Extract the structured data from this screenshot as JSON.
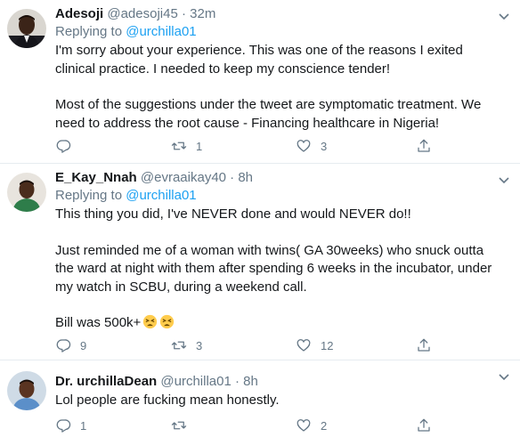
{
  "tweets": [
    {
      "name": "Adesoji",
      "handle": "@adesoji45",
      "separator": "·",
      "time": "32m",
      "replying_prefix": "Replying to",
      "replying_to": "@urchilla01",
      "paragraphs": [
        "I'm sorry about your experience. This was one of the reasons I exited clinical practice. I needed to keep my conscience tender!",
        "Most of the suggestions under the tweet are symptomatic treatment. We need to address the root cause - Financing healthcare in Nigeria!"
      ],
      "reply_count": "",
      "retweet_count": "1",
      "like_count": "3"
    },
    {
      "name": "E_Kay_Nnah",
      "handle": "@evraaikay40",
      "separator": "·",
      "time": "8h",
      "replying_prefix": "Replying to",
      "replying_to": "@urchilla01",
      "paragraphs": [
        "This thing you did, I've NEVER done and would NEVER do!!",
        "Just reminded me of a woman with twins( GA 30weeks) who snuck outta the ward at night with them after spending 6 weeks in the incubator, under my watch in SCBU, during a weekend call.",
        "Bill was 500k+"
      ],
      "emoji": "tired-face",
      "reply_count": "9",
      "retweet_count": "3",
      "like_count": "12"
    },
    {
      "name": "Dr. urchillaDean",
      "handle": "@urchilla01",
      "separator": "·",
      "time": "8h",
      "paragraphs": [
        "Lol people are fucking mean honestly."
      ],
      "reply_count": "1",
      "retweet_count": "",
      "like_count": "2"
    }
  ],
  "icons": {
    "reply": "reply-icon",
    "retweet": "retweet-icon",
    "like": "heart-icon",
    "share": "share-icon",
    "more": "chevron-down-icon"
  },
  "colors": {
    "text": "#14171a",
    "muted": "#657786",
    "link": "#1da1f2",
    "divider": "#e6ecf0",
    "background": "#ffffff"
  }
}
